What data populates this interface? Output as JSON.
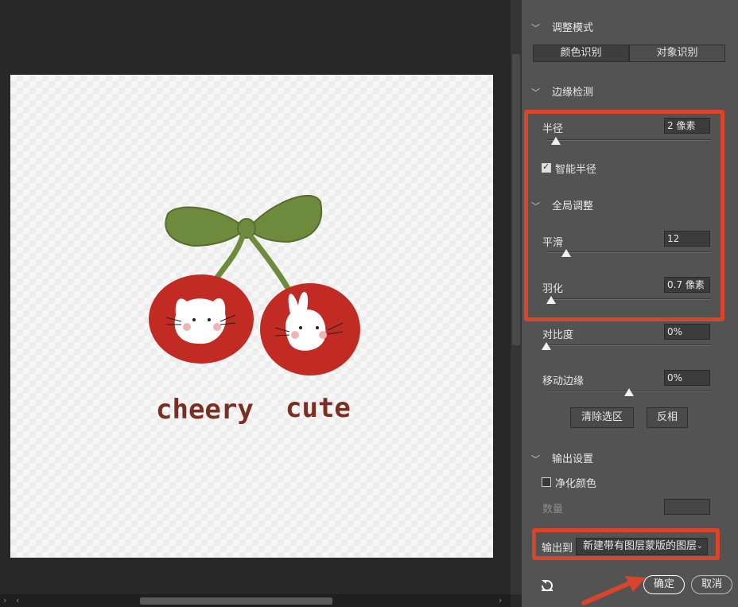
{
  "sections": {
    "view_mode": {
      "title": "调整模式",
      "tabs": [
        "颜色识别",
        "对象识别"
      ]
    },
    "edge_detection": {
      "title": "边缘检测",
      "radius_label": "半径",
      "radius_value": "2 像素",
      "radius_level": 0.06,
      "smart_radius_label": "智能半径",
      "smart_radius_checked": true
    },
    "global": {
      "title": "全局调整",
      "smooth_label": "平滑",
      "smooth_value": "12",
      "smooth_level": 0.12,
      "feather_label": "羽化",
      "feather_value": "0.7 像素",
      "feather_level": 0.03,
      "contrast_label": "对比度",
      "contrast_value": "0%",
      "contrast_level": 0.0,
      "shift_label": "移动边缘",
      "shift_value": "0%",
      "shift_level": 0.5,
      "clear_button": "清除选区",
      "invert_button": "反相"
    },
    "output": {
      "title": "输出设置",
      "decontam_label": "净化颜色",
      "decontam_checked": false,
      "amount_label": "数量",
      "output_to_label": "输出到",
      "output_to_value": "新建带有图层蒙版的图层"
    }
  },
  "footer": {
    "ok": "确定",
    "cancel": "取消"
  },
  "artwork": {
    "text_left": "cheery",
    "text_right": "cute"
  },
  "colors": {
    "highlight": "#d9442b",
    "cherry": "#c22a24",
    "leaf": "#6e8b3d",
    "text": "#7a2f22"
  },
  "icons": [
    "chevron-down-icon",
    "reset-icon",
    "dropdown-caret-icon",
    "chevron-right-icon",
    "chevron-left-icon"
  ]
}
